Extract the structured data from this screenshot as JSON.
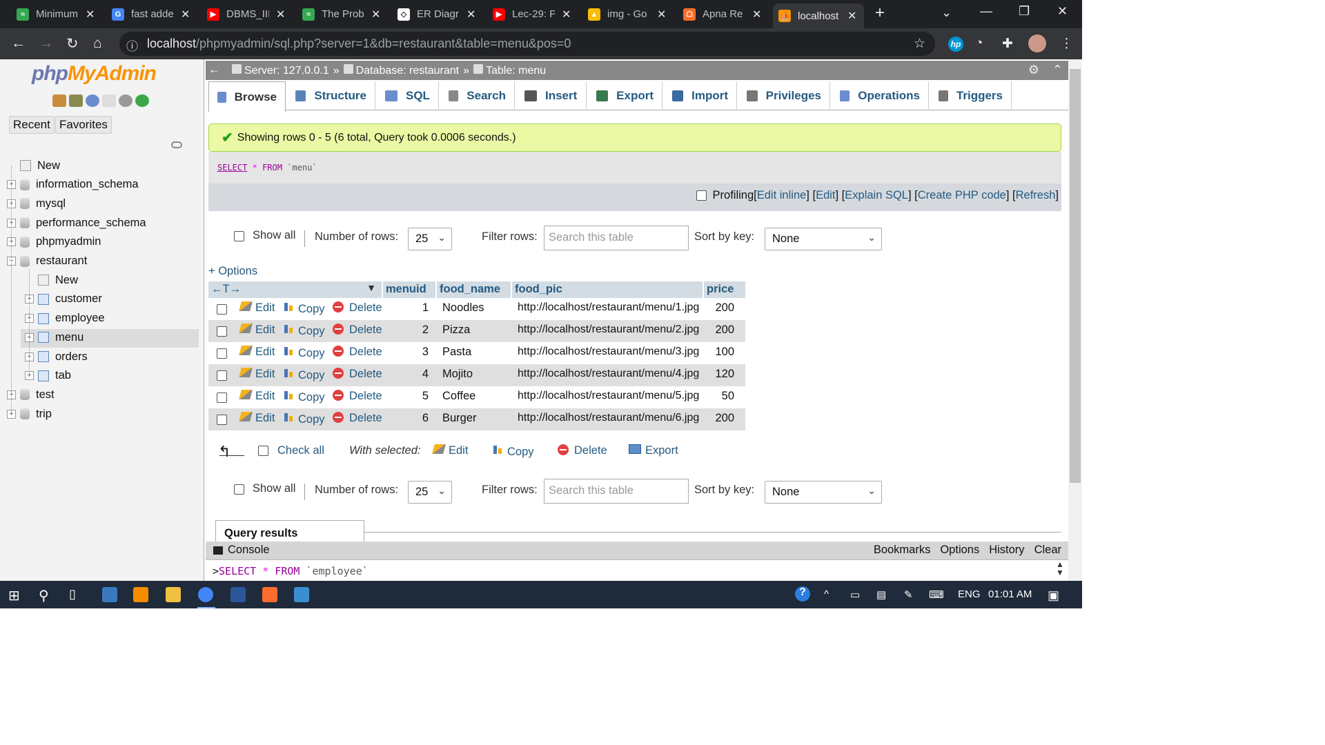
{
  "browser": {
    "tabs": [
      {
        "title": "Minimum",
        "color": "#34a853",
        "glyph": "≈"
      },
      {
        "title": "fast adde",
        "color": "#4285f4",
        "glyph": "G"
      },
      {
        "title": "DBMS_III",
        "color": "#ff0000",
        "glyph": "▶"
      },
      {
        "title": "The Prob",
        "color": "#34a853",
        "glyph": "≈"
      },
      {
        "title": "ER Diagr",
        "color": "#ffffff",
        "glyph": "◇"
      },
      {
        "title": "Lec-29: P",
        "color": "#ff0000",
        "glyph": "▶"
      },
      {
        "title": "img - Go",
        "color": "#fbbc04",
        "glyph": "▲"
      },
      {
        "title": "Apna Re",
        "color": "#ff6d2d",
        "glyph": "☖"
      },
      {
        "title": "localhost",
        "color": "#f89406",
        "glyph": "⛵"
      }
    ],
    "new_tab_icon": "plus-icon",
    "url_host": "localhost",
    "url_path": "/phpmyadmin/sql.php?server=1&db=restaurant&table=menu&pos=0"
  },
  "sidebar": {
    "logo_a": "php",
    "logo_b": "MyAdmin",
    "recent": "Recent",
    "favorites": "Favorites",
    "tree": [
      {
        "label": "New",
        "kind": "new",
        "level": 0
      },
      {
        "label": "information_schema",
        "kind": "db",
        "level": 0
      },
      {
        "label": "mysql",
        "kind": "db",
        "level": 0
      },
      {
        "label": "performance_schema",
        "kind": "db",
        "level": 0
      },
      {
        "label": "phpmyadmin",
        "kind": "db",
        "level": 0
      },
      {
        "label": "restaurant",
        "kind": "db-open",
        "level": 0
      },
      {
        "label": "New",
        "kind": "new",
        "level": 1
      },
      {
        "label": "customer",
        "kind": "table",
        "level": 1
      },
      {
        "label": "employee",
        "kind": "table",
        "level": 1
      },
      {
        "label": "menu",
        "kind": "table",
        "level": 1,
        "selected": true
      },
      {
        "label": "orders",
        "kind": "table",
        "level": 1
      },
      {
        "label": "tab",
        "kind": "table",
        "level": 1
      },
      {
        "label": "test",
        "kind": "db",
        "level": 0
      },
      {
        "label": "trip",
        "kind": "db",
        "level": 0
      }
    ]
  },
  "breadcrumb": {
    "server": "Server: 127.0.0.1",
    "database": "Database: restaurant",
    "table": "Table: menu",
    "sep": "»"
  },
  "tabs": [
    "Browse",
    "Structure",
    "SQL",
    "Search",
    "Insert",
    "Export",
    "Import",
    "Privileges",
    "Operations",
    "Triggers"
  ],
  "message": "Showing rows 0 - 5 (6 total, Query took 0.0006 seconds.)",
  "sql": {
    "kw1": "SELECT",
    "star": "*",
    "kw2": "FROM",
    "table": "`menu`"
  },
  "profiling": {
    "label": "Profiling",
    "links": [
      "Edit inline",
      "Edit",
      "Explain SQL",
      "Create PHP code",
      "Refresh"
    ]
  },
  "nav_controls": {
    "show_all": "Show all",
    "num_rows_label": "Number of rows:",
    "num_rows": "25",
    "filter_label": "Filter rows:",
    "filter_placeholder": "Search this table",
    "sort_label": "Sort by key:",
    "sort_value": "None"
  },
  "options_link": "+ Options",
  "columns": [
    "menuid",
    "food_name",
    "food_pic",
    "price"
  ],
  "row_actions": {
    "edit": "Edit",
    "copy": "Copy",
    "delete": "Delete"
  },
  "rows": [
    {
      "menuid": "1",
      "food_name": "Noodles",
      "food_pic": "http://localhost/restaurant/menu/1.jpg",
      "price": "200"
    },
    {
      "menuid": "2",
      "food_name": "Pizza",
      "food_pic": "http://localhost/restaurant/menu/2.jpg",
      "price": "200"
    },
    {
      "menuid": "3",
      "food_name": "Pasta",
      "food_pic": "http://localhost/restaurant/menu/3.jpg",
      "price": "100"
    },
    {
      "menuid": "4",
      "food_name": "Mojito",
      "food_pic": "http://localhost/restaurant/menu/4.jpg",
      "price": "120"
    },
    {
      "menuid": "5",
      "food_name": "Coffee",
      "food_pic": "http://localhost/restaurant/menu/5.jpg",
      "price": "50"
    },
    {
      "menuid": "6",
      "food_name": "Burger",
      "food_pic": "http://localhost/restaurant/menu/6.jpg",
      "price": "200"
    }
  ],
  "bulk": {
    "check_all": "Check all",
    "with_selected": "With selected:",
    "edit": "Edit",
    "copy": "Copy",
    "delete": "Delete",
    "export": "Export"
  },
  "query_results_ops": "Query results operations",
  "console": {
    "label": "Console",
    "links": [
      "Bookmarks",
      "Options",
      "History",
      "Clear"
    ],
    "input_kw1": "SELECT",
    "input_star": "*",
    "input_kw2": "FROM",
    "input_table": "`employee`"
  },
  "taskbar": {
    "lang": "ENG",
    "time": "01:01 AM"
  },
  "colors": {
    "accent": "#235a81",
    "success_bg": "#ebf8a4",
    "header_bg": "#d3dce3"
  }
}
